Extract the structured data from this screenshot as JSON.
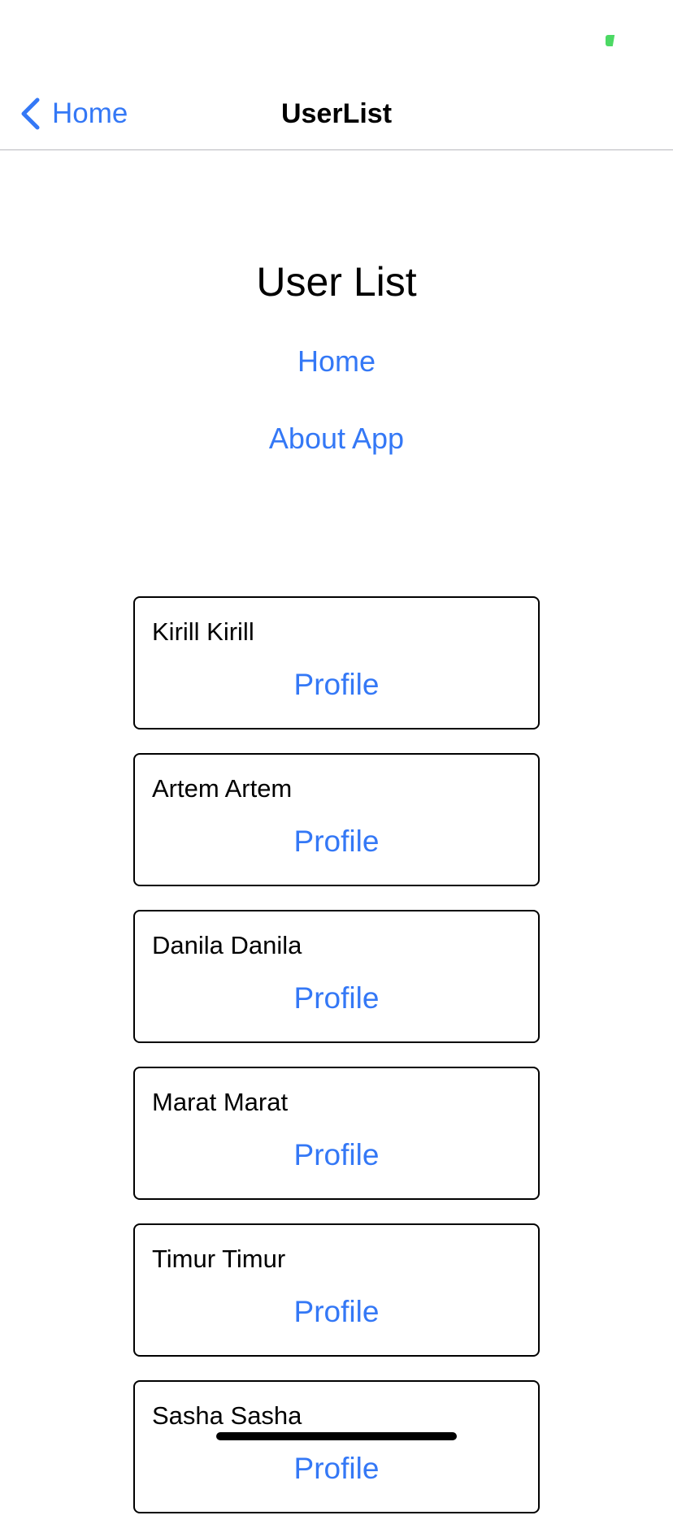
{
  "status_bar": {
    "battery_color": "#4cd964"
  },
  "nav_bar": {
    "back_label": "Home",
    "title": "UserList",
    "accent_color": "#3478f6"
  },
  "page": {
    "heading": "User List",
    "links": {
      "home": "Home",
      "about": "About App"
    }
  },
  "users": [
    {
      "name": "Kirill Kirill",
      "action": "Profile"
    },
    {
      "name": "Artem Artem",
      "action": "Profile"
    },
    {
      "name": "Danila Danila",
      "action": "Profile"
    },
    {
      "name": "Marat Marat",
      "action": "Profile"
    },
    {
      "name": "Timur Timur",
      "action": "Profile"
    },
    {
      "name": "Sasha Sasha",
      "action": "Profile"
    }
  ]
}
